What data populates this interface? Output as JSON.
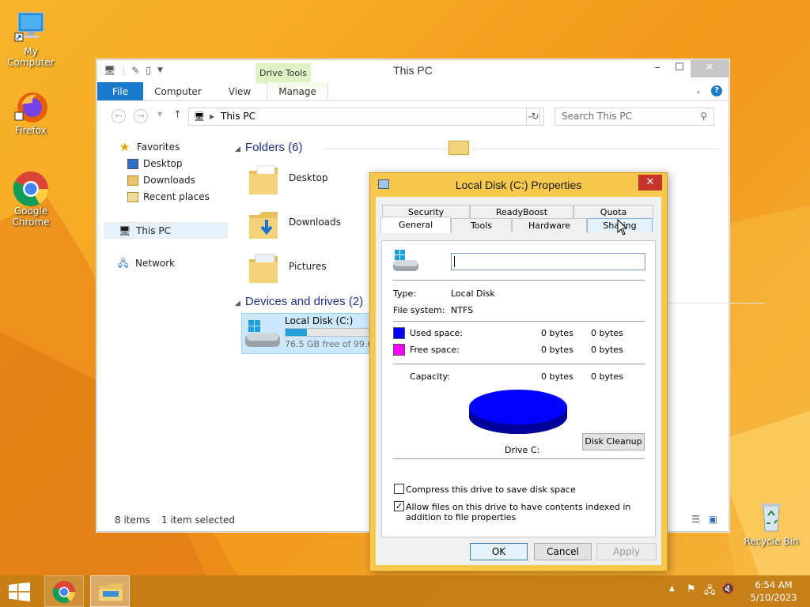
{
  "desktop": {
    "icons": [
      {
        "label": "My Computer"
      },
      {
        "label": "Firefox"
      },
      {
        "label": "Google Chrome"
      },
      {
        "label": "Recycle Bin"
      }
    ]
  },
  "explorer": {
    "title": "This PC",
    "contextual_tab": "Drive Tools",
    "ribbon_tabs": [
      "File",
      "Computer",
      "View",
      "Manage"
    ],
    "address": "This PC",
    "search_placeholder": "Search This PC",
    "nav": {
      "favorites": "Favorites",
      "desktop": "Desktop",
      "downloads": "Downloads",
      "recent": "Recent places",
      "this_pc": "This PC",
      "network": "Network"
    },
    "folders_header": "Folders (6)",
    "folders": [
      "Desktop",
      "Downloads",
      "Pictures"
    ],
    "drives_header": "Devices and drives (2)",
    "drive": {
      "name": "Local Disk (C:)",
      "free_text": "76.5 GB free of 99.6 G",
      "used_fraction": 0.23
    },
    "status": {
      "count": "8 items",
      "selected": "1 item selected"
    }
  },
  "dialog": {
    "title": "Local Disk (C:) Properties",
    "tabs_row1": [
      "Security",
      "ReadyBoost",
      "Quota"
    ],
    "tabs_row2": [
      "General",
      "Tools",
      "Hardware",
      "Sharing"
    ],
    "active_tab": "General",
    "name_value": "",
    "type_label": "Type:",
    "type_value": "Local Disk",
    "fs_label": "File system:",
    "fs_value": "NTFS",
    "used_label": "Used space:",
    "used_bytes": "0 bytes",
    "used_size": "0 bytes",
    "free_label": "Free space:",
    "free_bytes": "0 bytes",
    "free_size": "0 bytes",
    "capacity_label": "Capacity:",
    "capacity_bytes": "0 bytes",
    "capacity_size": "0 bytes",
    "drive_label": "Drive C:",
    "cleanup_button": "Disk Cleanup",
    "compress_label": "Compress this drive to save disk space",
    "compress_checked": false,
    "index_label": "Allow files on this drive to have contents indexed in addition to file properties",
    "index_checked": true,
    "ok": "OK",
    "cancel": "Cancel",
    "apply": "Apply",
    "colors": {
      "used": "#0000ff",
      "free": "#ff00ff"
    }
  },
  "taskbar": {
    "time": "6:54 AM",
    "date": "5/10/2023"
  }
}
